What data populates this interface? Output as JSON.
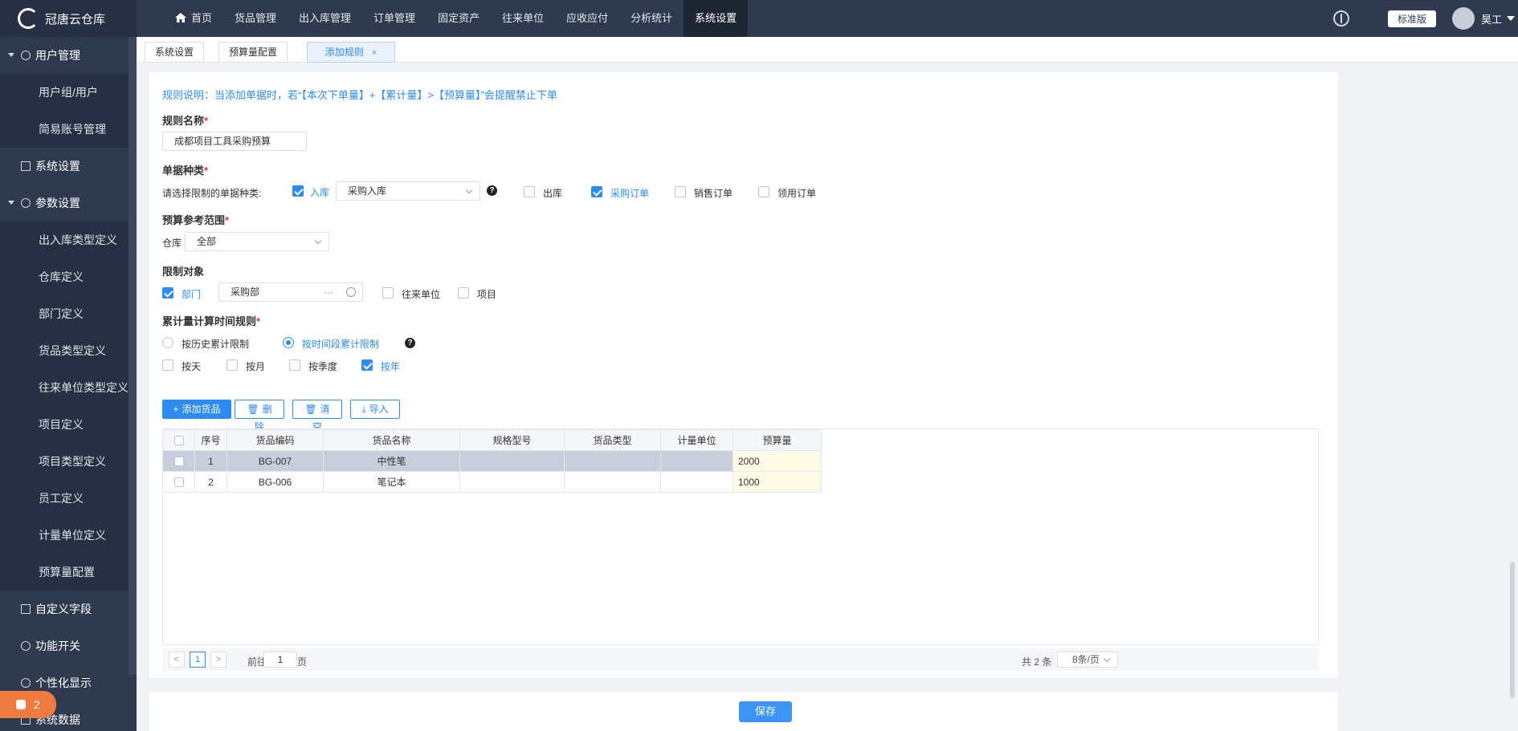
{
  "app": {
    "name": "冠唐云仓库",
    "edition": "标准版",
    "user": "昊工"
  },
  "nav": [
    "首页",
    "货品管理",
    "出入库管理",
    "订单管理",
    "固定资产",
    "往来单位",
    "应收应付",
    "分析统计",
    "系统设置"
  ],
  "sidebar": {
    "items": [
      {
        "label": "用户管理",
        "type": "group"
      },
      {
        "label": "用户组/用户",
        "type": "sub"
      },
      {
        "label": "简易账号管理",
        "type": "sub"
      },
      {
        "label": "系统设置",
        "type": "group"
      },
      {
        "label": "参数设置",
        "type": "group"
      },
      {
        "label": "出入库类型定义",
        "type": "sub"
      },
      {
        "label": "仓库定义",
        "type": "sub"
      },
      {
        "label": "部门定义",
        "type": "sub"
      },
      {
        "label": "货品类型定义",
        "type": "sub"
      },
      {
        "label": "往来单位类型定义",
        "type": "sub"
      },
      {
        "label": "项目定义",
        "type": "sub"
      },
      {
        "label": "项目类型定义",
        "type": "sub"
      },
      {
        "label": "员工定义",
        "type": "sub"
      },
      {
        "label": "计量单位定义",
        "type": "sub"
      },
      {
        "label": "预算量配置",
        "type": "sub"
      },
      {
        "label": "自定义字段",
        "type": "group"
      },
      {
        "label": "功能开关",
        "type": "group"
      },
      {
        "label": "个性化显示",
        "type": "group"
      },
      {
        "label": "系统数据",
        "type": "group"
      }
    ],
    "badge": "2"
  },
  "tabs": {
    "t1": "系统设置",
    "t2": "预算量配置",
    "t3": "添加规则",
    "close": "×"
  },
  "form": {
    "description": "规则说明：当添加单据时，若“【本次下单量】+【累计量】>【预算量】”会提醒禁止下单",
    "rule_name_label": "规则名称",
    "rule_name_value": "成都项目工具采购预算",
    "doc_type_label": "单据种类",
    "doc_type_hint": "请选择限制的单据种类:",
    "doc_in": "入库",
    "doc_in_select": "采购入库",
    "doc_out": "出库",
    "doc_purchase": "采购订单",
    "doc_sales": "销售订单",
    "doc_requisition": "领用订单",
    "scope_label": "预算参考范围",
    "warehouse_label": "仓库",
    "warehouse_value": "全部",
    "target_label": "限制对象",
    "target_dept": "部门",
    "target_dept_value": "采购部",
    "target_partner": "往来单位",
    "target_project": "项目",
    "time_rule_label": "累计量计算时间规则",
    "radio_history": "按历史累计限制",
    "radio_period": "按时间段累计限制",
    "by_day": "按天",
    "by_month": "按月",
    "by_quarter": "按季度",
    "by_year": "按年",
    "required": "*",
    "ellipsis": "···"
  },
  "toolbar": {
    "add": "添加货品",
    "delete": "删除",
    "clear": "清空",
    "import": "导入"
  },
  "table": {
    "headers": [
      "序号",
      "货品编码",
      "货品名称",
      "规格型号",
      "货品类型",
      "计量单位",
      "预算量"
    ],
    "rows": [
      {
        "no": "1",
        "code": "BG-007",
        "name": "中性笔",
        "spec": "",
        "type": "",
        "unit": "",
        "budget": "2000"
      },
      {
        "no": "2",
        "code": "BG-006",
        "name": "笔记本",
        "spec": "",
        "type": "",
        "unit": "",
        "budget": "1000"
      }
    ]
  },
  "pager": {
    "current": "1",
    "goto": "前往",
    "page_value": "1",
    "page_suffix": "页",
    "total": "共 2 条",
    "page_size": "8条/页",
    "prev": "<",
    "next": ">"
  },
  "footer": {
    "save": "保存"
  }
}
